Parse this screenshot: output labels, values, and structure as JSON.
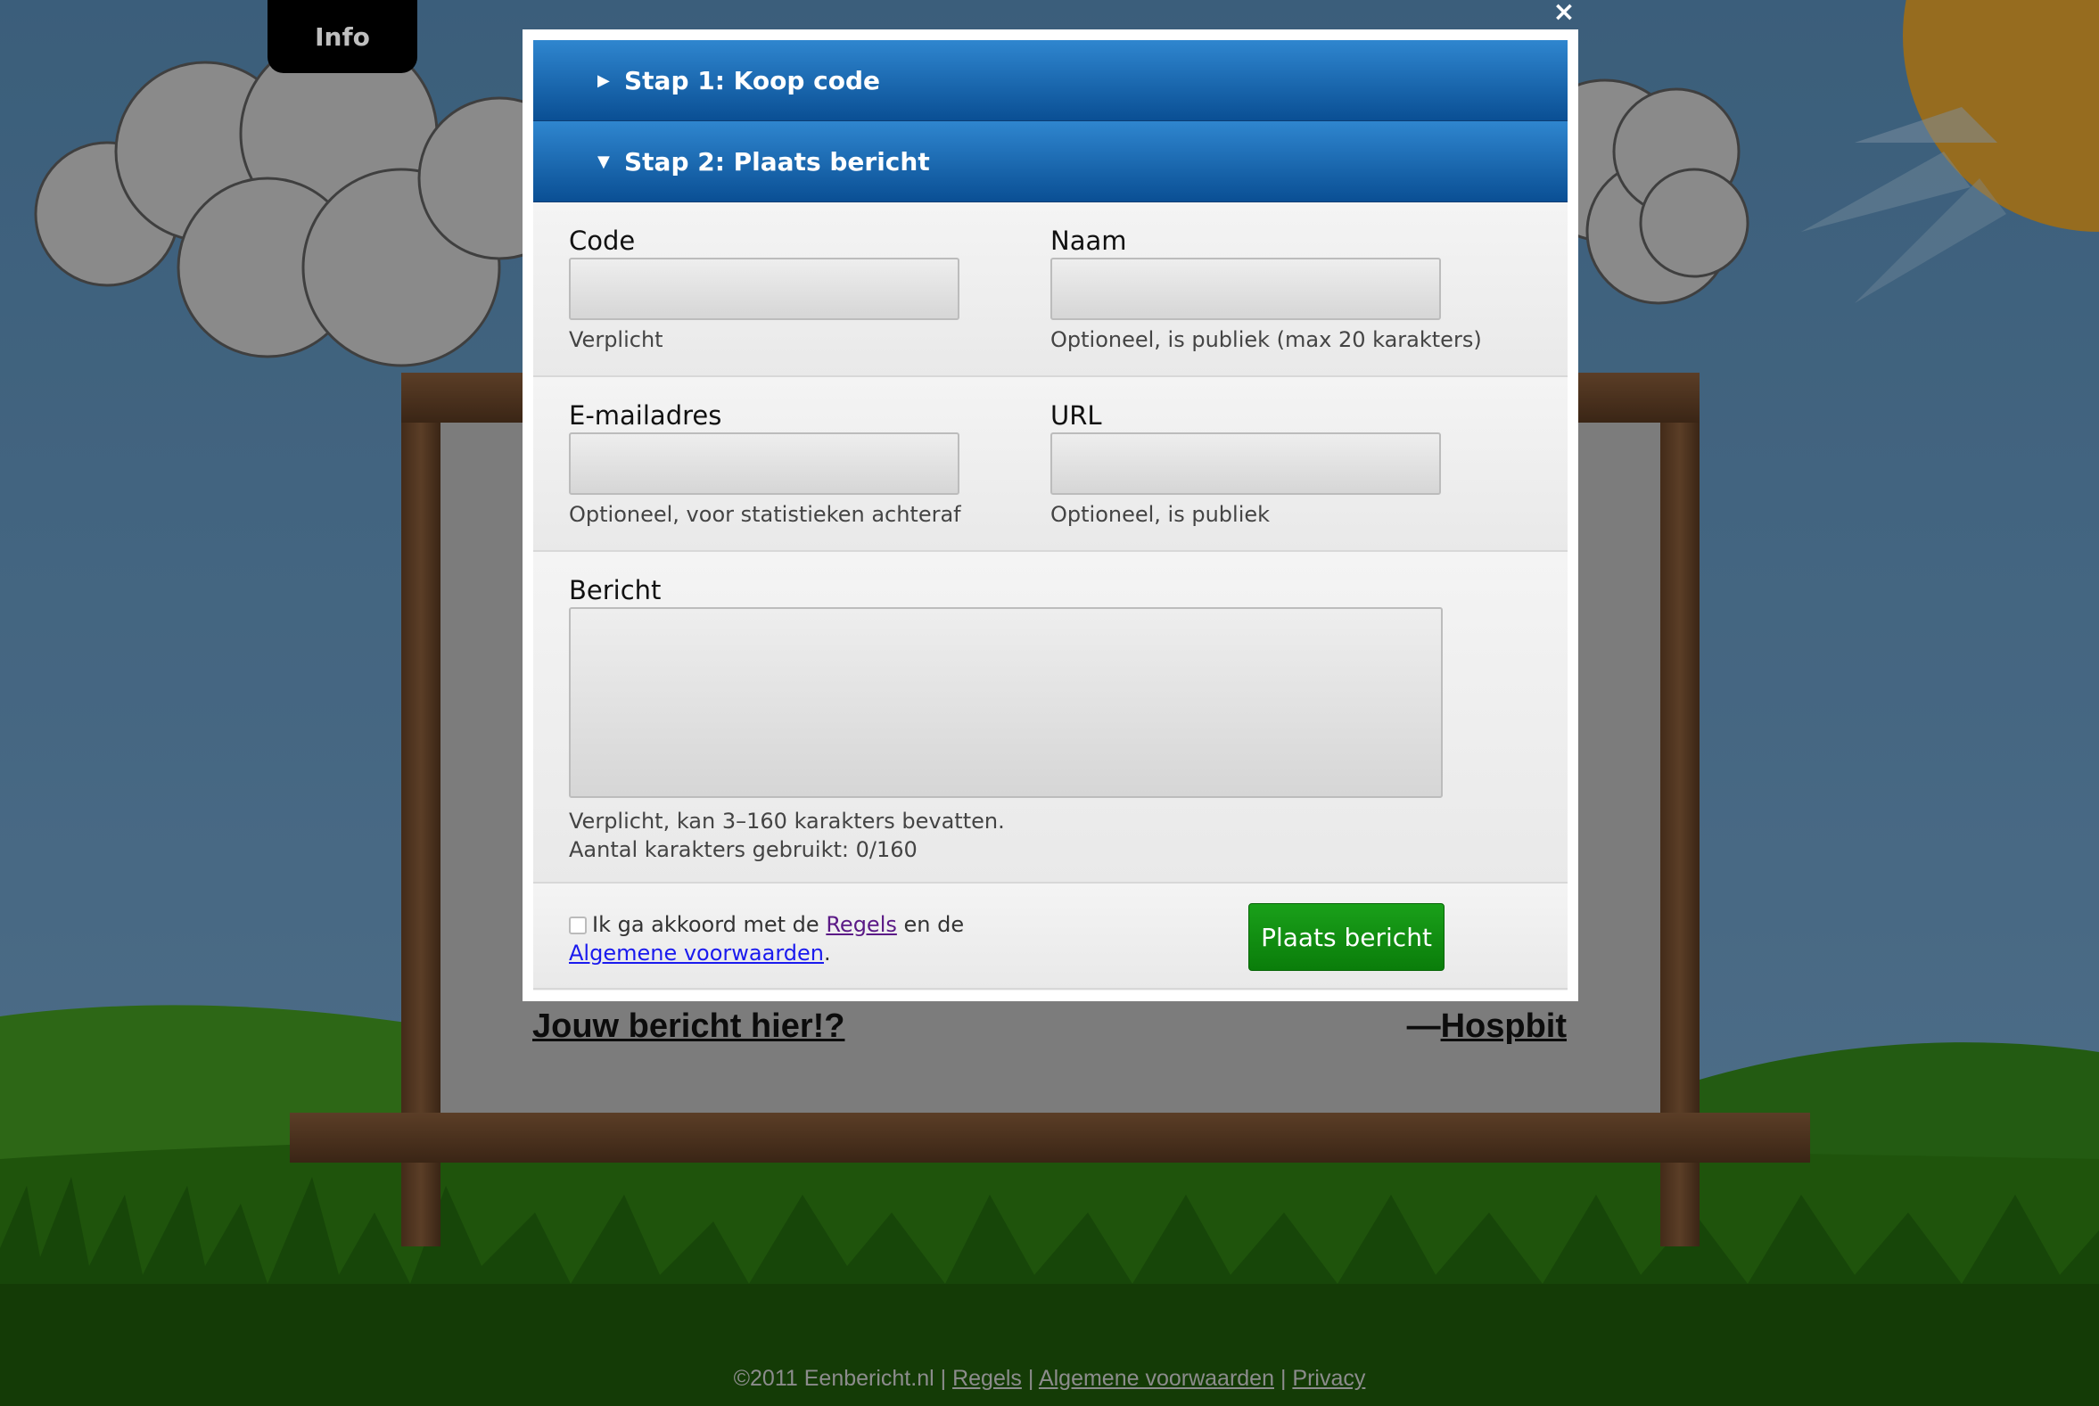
{
  "nav": {
    "info_label": "Info"
  },
  "board": {
    "caption": "Jouw bericht hier!?",
    "dash": "—",
    "author": "Hospbit"
  },
  "footer": {
    "copyright": "©2011 Eenbericht.nl",
    "sep": "|",
    "regels": "Regels",
    "voorwaarden": "Algemene voorwaarden",
    "privacy": "Privacy"
  },
  "modal": {
    "close_glyph": "×",
    "step1": {
      "label": "Stap 1: Koop code",
      "expanded": false
    },
    "step2": {
      "label": "Stap 2: Plaats bericht",
      "expanded": true
    },
    "fields": {
      "code": {
        "label": "Code",
        "hint": "Verplicht",
        "value": ""
      },
      "naam": {
        "label": "Naam",
        "hint": "Optioneel, is publiek (max 20 karakters)",
        "value": ""
      },
      "email": {
        "label": "E-mailadres",
        "hint": "Optioneel, voor statistieken achteraf",
        "value": ""
      },
      "url": {
        "label": "URL",
        "hint": "Optioneel, is publiek",
        "value": ""
      },
      "bericht": {
        "label": "Bericht",
        "hint1": "Verplicht, kan 3–160 karakters bevatten.",
        "hint2": "Aantal karakters gebruikt: 0/160",
        "value": ""
      }
    },
    "agree": {
      "prefix": "Ik ga akkoord met de",
      "regels": "Regels",
      "middle": "en de",
      "voorwaarden": "Algemene voorwaarden",
      "suffix": ".",
      "checked": false
    },
    "submit_label": "Plaats bericht"
  },
  "colors": {
    "accordion_top": "#2f86cf",
    "accordion_bottom": "#0a4f94",
    "submit_green": "#0a8a0a",
    "sky": "#5a87a9",
    "sun": "#c8902a"
  }
}
